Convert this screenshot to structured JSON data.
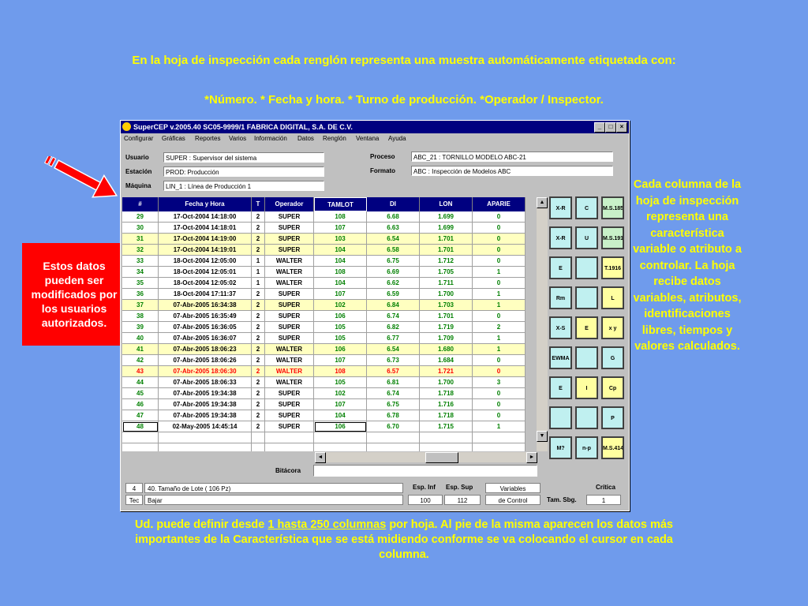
{
  "captions": {
    "top_line1": "En la hoja de inspección cada renglón representa una muestra automáticamente etiquetada con:",
    "top_line2": "*Número. * Fecha y hora. * Turno de producción. *Operador / Inspector.",
    "left_box": "Estos datos pueden ser modificados por los usuarios autorizados.",
    "right": "Cada columna de la hoja de inspección representa una característica variable o atributo a controlar. La hoja recibe datos variables, atributos, identificaciones libres, tiempos y valores calculados.",
    "bottom_pre": "Ud. puede definir desde ",
    "bottom_link": "1 hasta 250 columnas",
    "bottom_post": " por hoja. Al pie de la misma aparecen los datos más importantes de la Característica que se está midiendo conforme se va colocando el cursor en cada columna."
  },
  "window": {
    "title": "SuperCEP v.2005.40  SC05-9999/1  FABRICA DIGITAL, S.A. DE C.V.",
    "controls": {
      "minimize": "_",
      "maximize": "□",
      "close": "×"
    }
  },
  "menu": [
    "Configurar",
    "Gráficas",
    "Reportes",
    "Varios",
    "Información",
    "Datos",
    "Renglón",
    "Ventana",
    "Ayuda"
  ],
  "header_fields": {
    "usuario_label": "Usuario",
    "usuario_value": "SUPER   : Supervisor del sistema",
    "estacion_label": "Estación",
    "estacion_value": "PROD: Producción",
    "maquina_label": "Máquina",
    "maquina_value": "LIN_1   : Línea de Producción 1",
    "proceso_label": "Proceso",
    "proceso_value": "ABC_21         : TORNILLO MODELO ABC-21",
    "formato_label": "Formato",
    "formato_value": "ABC     : Inspección de Modelos ABC"
  },
  "grid": {
    "columns": [
      "#",
      "Fecha y Hora",
      "T",
      "Operador",
      "TAMLOT",
      "DI",
      "LON",
      "APARIE"
    ],
    "rows": [
      [
        "29",
        "17-Oct-2004  14:18:00",
        "2",
        "SUPER",
        "108",
        "6.68",
        "1.699",
        "0"
      ],
      [
        "30",
        "17-Oct-2004  14:18:01",
        "2",
        "SUPER",
        "107",
        "6.63",
        "1.699",
        "0"
      ],
      [
        "31",
        "17-Oct-2004  14:19:00",
        "2",
        "SUPER",
        "103",
        "6.54",
        "1.701",
        "0"
      ],
      [
        "32",
        "17-Oct-2004  14:19:01",
        "2",
        "SUPER",
        "104",
        "6.58",
        "1.701",
        "0"
      ],
      [
        "33",
        "18-Oct-2004  12:05:00",
        "1",
        "WALTER",
        "104",
        "6.75",
        "1.712",
        "0"
      ],
      [
        "34",
        "18-Oct-2004  12:05:01",
        "1",
        "WALTER",
        "108",
        "6.69",
        "1.705",
        "1"
      ],
      [
        "35",
        "18-Oct-2004  12:05:02",
        "1",
        "WALTER",
        "104",
        "6.62",
        "1.711",
        "0"
      ],
      [
        "36",
        "18-Oct-2004  17:11:37",
        "2",
        "SUPER",
        "107",
        "6.59",
        "1.700",
        "1"
      ],
      [
        "37",
        "07-Abr-2005  16:34:38",
        "2",
        "SUPER",
        "102",
        "6.84",
        "1.703",
        "1"
      ],
      [
        "38",
        "07-Abr-2005  16:35:49",
        "2",
        "SUPER",
        "106",
        "6.74",
        "1.701",
        "0"
      ],
      [
        "39",
        "07-Abr-2005  16:36:05",
        "2",
        "SUPER",
        "105",
        "6.82",
        "1.719",
        "2"
      ],
      [
        "40",
        "07-Abr-2005  16:36:07",
        "2",
        "SUPER",
        "105",
        "6.77",
        "1.709",
        "1"
      ],
      [
        "41",
        "07-Abr-2005  18:06:23",
        "2",
        "WALTER",
        "106",
        "6.54",
        "1.680",
        "1"
      ],
      [
        "42",
        "07-Abr-2005  18:06:26",
        "2",
        "WALTER",
        "107",
        "6.73",
        "1.684",
        "0"
      ],
      [
        "43",
        "07-Abr-2005  18:06:30",
        "2",
        "WALTER",
        "108",
        "6.57",
        "1.721",
        "0"
      ],
      [
        "44",
        "07-Abr-2005  18:06:33",
        "2",
        "WALTER",
        "105",
        "6.81",
        "1.700",
        "3"
      ],
      [
        "45",
        "07-Abr-2005  19:34:38",
        "2",
        "SUPER",
        "102",
        "6.74",
        "1.718",
        "0"
      ],
      [
        "46",
        "07-Abr-2005  19:34:38",
        "2",
        "SUPER",
        "107",
        "6.75",
        "1.716",
        "0"
      ],
      [
        "47",
        "07-Abr-2005  19:34:38",
        "2",
        "SUPER",
        "104",
        "6.78",
        "1.718",
        "0"
      ],
      [
        "48",
        "02-May-2005  14:45:14",
        "2",
        "SUPER",
        "106",
        "6.70",
        "1.715",
        "1"
      ]
    ]
  },
  "bitacora_label": "Bitácora",
  "toolbar": [
    {
      "icon": "xr-chart-icon",
      "text": "X-R"
    },
    {
      "icon": "c-chart-icon",
      "text": "C"
    },
    {
      "icon": "ms185-icon",
      "text": "M.S.185"
    },
    {
      "icon": "xr2-chart-icon",
      "text": "X-R"
    },
    {
      "icon": "u-chart-icon",
      "text": "U"
    },
    {
      "icon": "ms1916-icon",
      "text": "M.S.1916"
    },
    {
      "icon": "e-chart-icon",
      "text": "E"
    },
    {
      "icon": "histogram-icon",
      "text": ""
    },
    {
      "icon": "t1916-icon",
      "text": "T.1916"
    },
    {
      "icon": "xrm-chart-icon",
      "text": "Rm"
    },
    {
      "icon": "bars-icon",
      "text": ""
    },
    {
      "icon": "l-chart-icon",
      "text": "L"
    },
    {
      "icon": "xs-chart-icon",
      "text": "X-S"
    },
    {
      "icon": "e2-chart-icon",
      "text": "E"
    },
    {
      "icon": "xy-chart-icon",
      "text": "x y"
    },
    {
      "icon": "ewma-chart-icon",
      "text": "EWMA"
    },
    {
      "icon": "flow-icon",
      "text": ""
    },
    {
      "icon": "g-chart-icon",
      "text": "G"
    },
    {
      "icon": "e3-chart-icon",
      "text": "E"
    },
    {
      "icon": "i-chart-icon",
      "text": "I"
    },
    {
      "icon": "cp-chart-icon",
      "text": "Cp"
    },
    {
      "icon": "rainbow-icon",
      "text": ""
    },
    {
      "icon": "histogram2-icon",
      "text": ""
    },
    {
      "icon": "p-chart-icon",
      "text": "P"
    },
    {
      "icon": "m-chart-icon",
      "text": "M?"
    },
    {
      "icon": "np-chart-icon",
      "text": "n-p"
    },
    {
      "icon": "ms414-icon",
      "text": "M.S.414"
    }
  ],
  "footer": {
    "num": "4",
    "desc": "40. Tamaño de Lote ( 106 Pz)",
    "tec_label": "Tec",
    "tec_value": "Bajar",
    "esp_inf_label": "Esp. Inf",
    "esp_sup_label": "Esp. Sup",
    "esp_inf_value": "100",
    "esp_sup_value": "112",
    "tipo1": "Variables",
    "tipo2": "de Control",
    "tam_sbg_label": "Tam. Sbg.",
    "critica_label": "Crítica",
    "critica_value": "1"
  },
  "colors": {
    "background": "#6f9bec",
    "caption": "#ffff00",
    "header": "#000080",
    "value_green": "#008000",
    "highlight_red": "#ff0000"
  }
}
